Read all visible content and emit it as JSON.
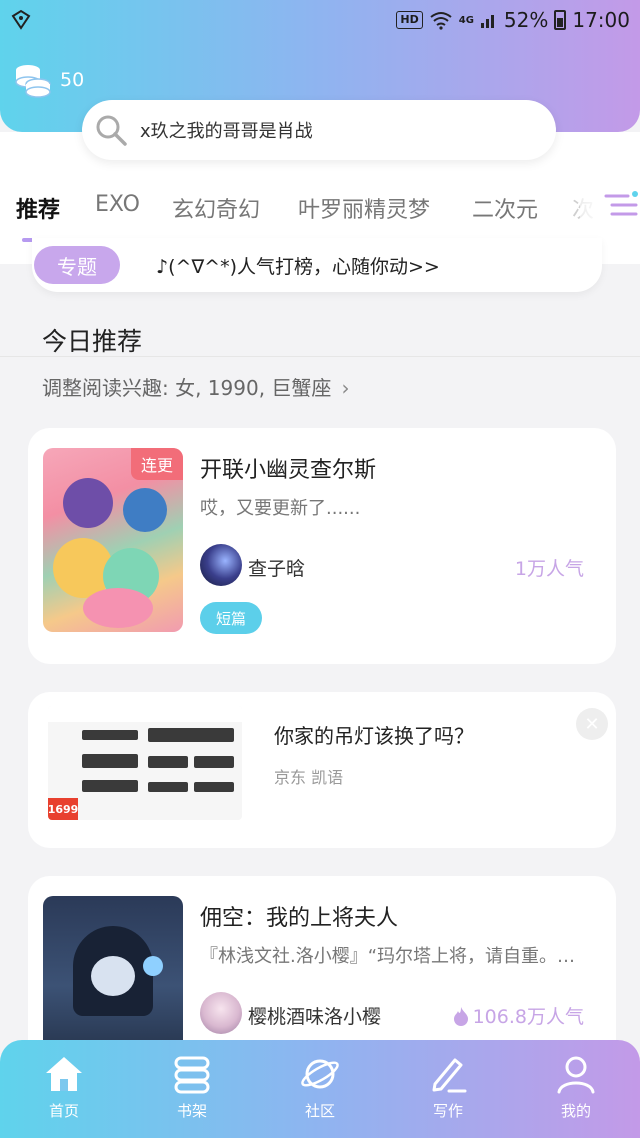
{
  "status_bar": {
    "hd": "HD",
    "network": "4G",
    "battery": "52%",
    "time": "17:00"
  },
  "header": {
    "coins": "50",
    "search_placeholder": "x玖之我的哥哥是肖战"
  },
  "tabs": [
    "推荐",
    "EXO",
    "玄幻奇幻",
    "叶罗丽精灵梦",
    "二次元",
    "次"
  ],
  "topic": {
    "pill": "专题",
    "text": "♪(^∇^*)人气打榜，心随你动>>"
  },
  "section": {
    "title": "今日推荐",
    "interest": "调整阅读兴趣: 女, 1990, 巨蟹座"
  },
  "cards": [
    {
      "badge": "连更",
      "title": "开联小幽灵查尔斯",
      "desc": "哎，又要更新了......",
      "author": "查子晗",
      "popularity": "1万人气",
      "tag": "短篇"
    },
    {
      "title": "佣空：我的上将夫人",
      "desc": "『林浅文社.洛小樱』“玛尔塔上将，请自重。…",
      "author": "樱桃酒味洛小樱",
      "popularity": "106.8万人气"
    }
  ],
  "ad": {
    "title": "你家的吊灯该换了吗？",
    "source": "京东 凯语",
    "price": "1699"
  },
  "bottom_nav": [
    {
      "label": "首页",
      "icon": "home-icon"
    },
    {
      "label": "书架",
      "icon": "bookshelf-icon"
    },
    {
      "label": "社区",
      "icon": "planet-icon"
    },
    {
      "label": "写作",
      "icon": "pen-icon"
    },
    {
      "label": "我的",
      "icon": "user-icon"
    }
  ],
  "colors": {
    "gradient_start": "#5fd3ec",
    "gradient_end": "#c39ae8",
    "accent_purple": "#c8a7ec",
    "tag_blue": "#5ccfea",
    "badge_red": "#f26d79"
  }
}
